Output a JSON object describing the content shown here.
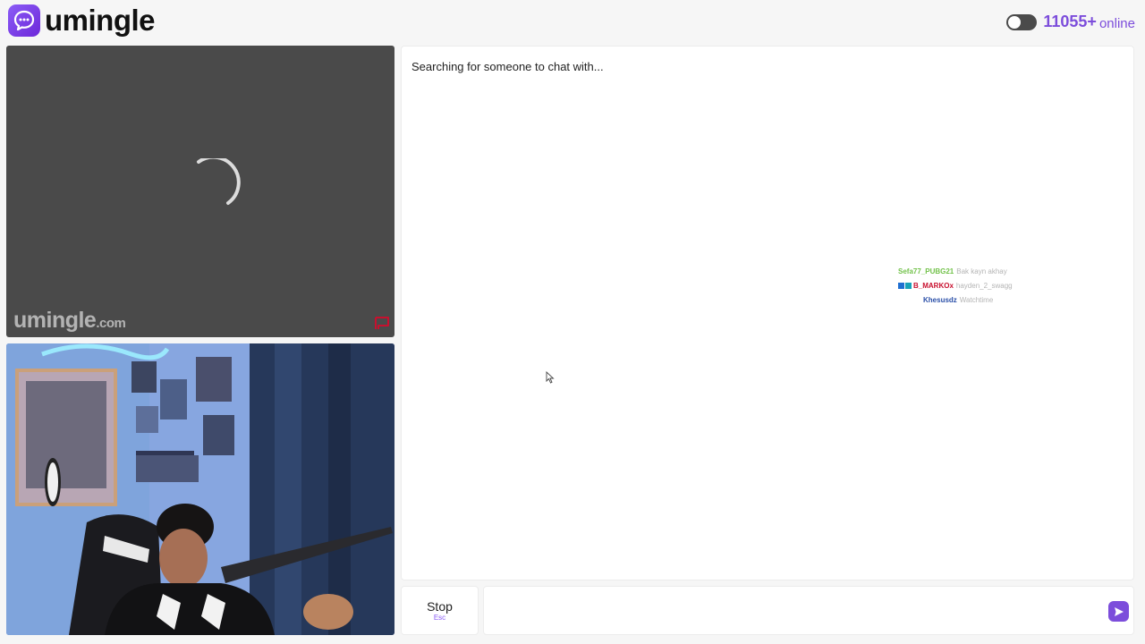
{
  "app": {
    "name": "umingle",
    "logo_icon": "chat-bubble-icon",
    "brand_color": "#7c4ddb"
  },
  "header": {
    "online_count": "11055+",
    "online_label": "online",
    "toggle_on": false
  },
  "remote_video": {
    "watermark_main": "umingle",
    "watermark_suffix": ".com",
    "state": "loading",
    "report_icon": "flag-icon"
  },
  "local_video": {
    "state": "live-camera"
  },
  "chat": {
    "status": "Searching for someone to chat with...",
    "stream_overlay": [
      {
        "user": "Sefa77_PUBG21",
        "message": "Bak kayn akhay",
        "color": "#72c24a"
      },
      {
        "user": "B_MARKOx",
        "message": "hayden_2_swagg",
        "color": "#c8102e",
        "badge_colors": [
          "#1f6fd1",
          "#17a2b8"
        ]
      },
      {
        "user": "Khesusdz",
        "message": "Watchtime",
        "color": "#2a4fa8"
      }
    ]
  },
  "controls": {
    "stop_label": "Stop",
    "stop_hint": "Esc",
    "message_placeholder": "",
    "send_icon": "send-icon"
  }
}
